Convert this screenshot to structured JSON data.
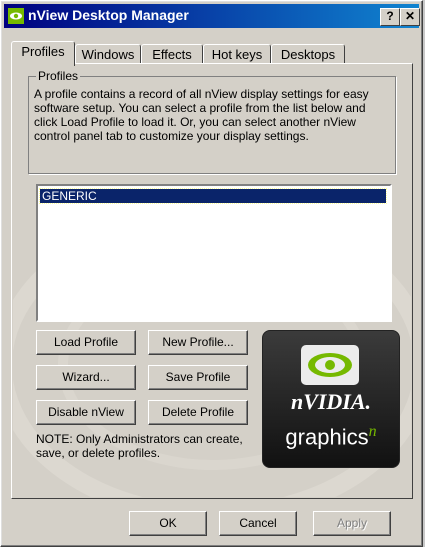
{
  "window": {
    "title": "nView Desktop Manager",
    "help_label": "?",
    "close_label": "✕",
    "icon": "nvidia-eye-icon"
  },
  "tabs": [
    {
      "label": "Profiles"
    },
    {
      "label": "Windows"
    },
    {
      "label": "Effects"
    },
    {
      "label": "Hot keys"
    },
    {
      "label": "Desktops"
    }
  ],
  "profiles_group": {
    "label": "Profiles",
    "description": "A profile contains a record of all nView display settings for easy software setup. You can select a profile from the list below and click Load Profile to load it. Or, you can select another nView control panel tab to customize your display settings."
  },
  "profiles_list": {
    "items": [
      "GENERIC"
    ],
    "selected": "GENERIC"
  },
  "buttons": {
    "load": "Load Profile",
    "new": "New Profile...",
    "wizard": "Wizard...",
    "save": "Save Profile",
    "disable": "Disable nView",
    "delete": "Delete Profile"
  },
  "note": "NOTE: Only Administrators can create, save, or delete profiles.",
  "logo": {
    "brand": "nVIDIA.",
    "sub": "graphics",
    "superscript": "n"
  },
  "footer": {
    "ok": "OK",
    "cancel": "Cancel",
    "apply": "Apply"
  },
  "colors": {
    "title_start": "#000080",
    "title_end": "#1084d0",
    "selection": "#0a246a",
    "nvidia_green": "#76b900"
  }
}
